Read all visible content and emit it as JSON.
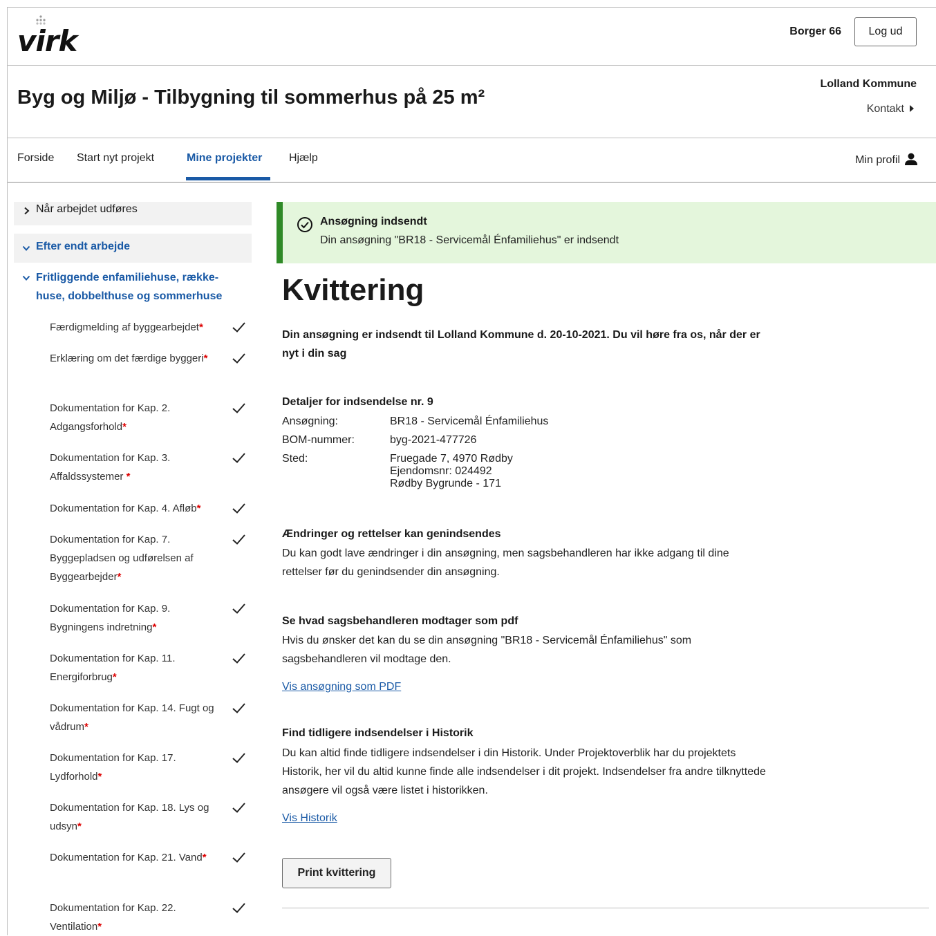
{
  "header": {
    "logo_text": "virk",
    "user_name": "Borger 66",
    "logout_label": "Log ud"
  },
  "titlebar": {
    "title": "Byg og Miljø - Tilbygning til sommerhus på 25 m²",
    "municipality": "Lolland Kommune",
    "contact_label": "Kontakt"
  },
  "nav": {
    "items": [
      {
        "label": "Forside"
      },
      {
        "label": "Start nyt projekt"
      },
      {
        "label": "Mine projekter"
      },
      {
        "label": "Hjælp"
      }
    ],
    "active_index": 2,
    "profile_label": "Min profil"
  },
  "sidebar": {
    "group1_label": "Når arbejdet udføres",
    "group2_label": "Efter endt arbejde",
    "section_label": "Fritliggende enfamiliehuse, række-huse, dobbelthuse og sommerhuse",
    "steps": [
      {
        "label": "Færdigmelding af byggearbejdet",
        "required": "*",
        "done": true
      },
      {
        "label": "Erklæring om det færdige byggeri",
        "required": "*",
        "done": true
      },
      {
        "label": "Dokumentation for Kap. 2. Adgangsforhold",
        "required": "*",
        "done": true
      },
      {
        "label": "Dokumentation for Kap. 3. Affaldssystemer ",
        "required": "*",
        "done": true
      },
      {
        "label": "Dokumentation for Kap. 4. Afløb",
        "required": "*",
        "done": true
      },
      {
        "label": "Dokumentation for Kap. 7. Byggepladsen og udførelsen af Byggearbejder",
        "required": "*",
        "done": true
      },
      {
        "label": "Dokumentation for Kap. 9. Bygningens indretning",
        "required": "*",
        "done": true
      },
      {
        "label": "Dokumentation for Kap. 11. Energiforbrug",
        "required": "*",
        "done": true
      },
      {
        "label": "Dokumentation for Kap. 14. Fugt og vådrum",
        "required": "*",
        "done": true
      },
      {
        "label": "Dokumentation for Kap. 17. Lydforhold",
        "required": "*",
        "done": true
      },
      {
        "label": "Dokumentation for Kap. 18. Lys og udsyn",
        "required": "*",
        "done": true
      },
      {
        "label": "Dokumentation for Kap. 21. Vand",
        "required": "*",
        "done": true
      },
      {
        "label": "Dokumentation for Kap. 22. Ventilation",
        "required": "*",
        "done": true
      }
    ]
  },
  "alert": {
    "title": "Ansøgning indsendt",
    "text": "Din ansøgning \"BR18 - Servicemål Énfamiliehus\" er indsendt"
  },
  "receipt": {
    "heading": "Kvittering",
    "lead": "Din ansøgning er indsendt til Lolland Kommune d. 20-10-2021. Du vil høre fra os, når der er nyt i din sag",
    "details_title": "Detaljer for indsendelse nr. 9",
    "details": {
      "application_key": "Ansøgning:",
      "application_value": "BR18 - Servicemål Énfamiliehus",
      "bom_key": "BOM-nummer:",
      "bom_value": "byg-2021-477726",
      "place_key": "Sted:",
      "place_line1": "Fruegade 7, 4970 Rødby",
      "place_line2": "Ejendomsnr: 024492",
      "place_line3": "Rødby Bygrunde - 171"
    },
    "changes_title": "Ændringer og rettelser kan genindsendes",
    "changes_text": "Du kan godt lave ændringer i din ansøgning, men sagsbehandleren har ikke adgang til dine rettelser før du genindsender din ansøgning.",
    "pdf_title": "Se hvad sagsbehandleren modtager som pdf",
    "pdf_text": "Hvis du ønsker det kan du se din ansøgning \"BR18 - Servicemål Énfamiliehus\" som sagsbehandleren vil modtage den.",
    "pdf_link": "Vis ansøgning som PDF",
    "history_title": "Find tidligere indsendelser i Historik",
    "history_text": "Du kan altid finde tidligere indsendelser i din Historik. Under Projektoverblik har du projektets Historik, her vil du altid kunne finde alle indsendelser i dit projekt. Indsendelser fra andre tilknyttede ansøgere vil også være listet i historikken.",
    "history_link": "Vis Historik",
    "print_label": "Print kvittering"
  },
  "colors": {
    "link_blue": "#1a5aa6",
    "success_green": "#2f8a27",
    "success_bg": "#e4f6dc",
    "required_red": "#dd0000"
  }
}
